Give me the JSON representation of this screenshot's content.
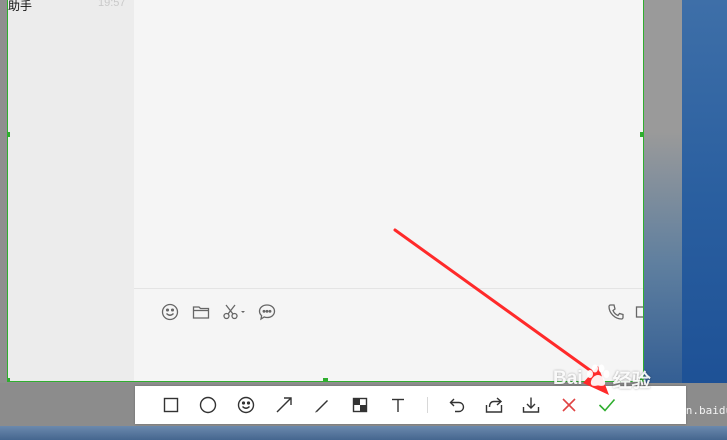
{
  "chat": {
    "name": "助手",
    "time": "19:57"
  },
  "input_bar": {
    "icons": [
      "emoji-icon",
      "folder-icon",
      "scissors-icon",
      "chat-bubble-icon",
      "phone-icon",
      "video-icon"
    ]
  },
  "toolbar": {
    "tools": [
      "rectangle-icon",
      "ellipse-icon",
      "emoji-icon",
      "arrow-icon",
      "pen-icon",
      "mosaic-icon",
      "text-icon",
      "undo-icon",
      "share-icon",
      "download-icon",
      "cancel-icon",
      "confirm-icon"
    ]
  },
  "watermark": {
    "text_left": "Bai",
    "text_right": "经验",
    "sub": "jingyan.baidu.com"
  },
  "colors": {
    "selection_border": "#2fae2f",
    "cancel": "#e04343",
    "confirm": "#2fae2f",
    "annotation_arrow": "#ff2a2a"
  }
}
